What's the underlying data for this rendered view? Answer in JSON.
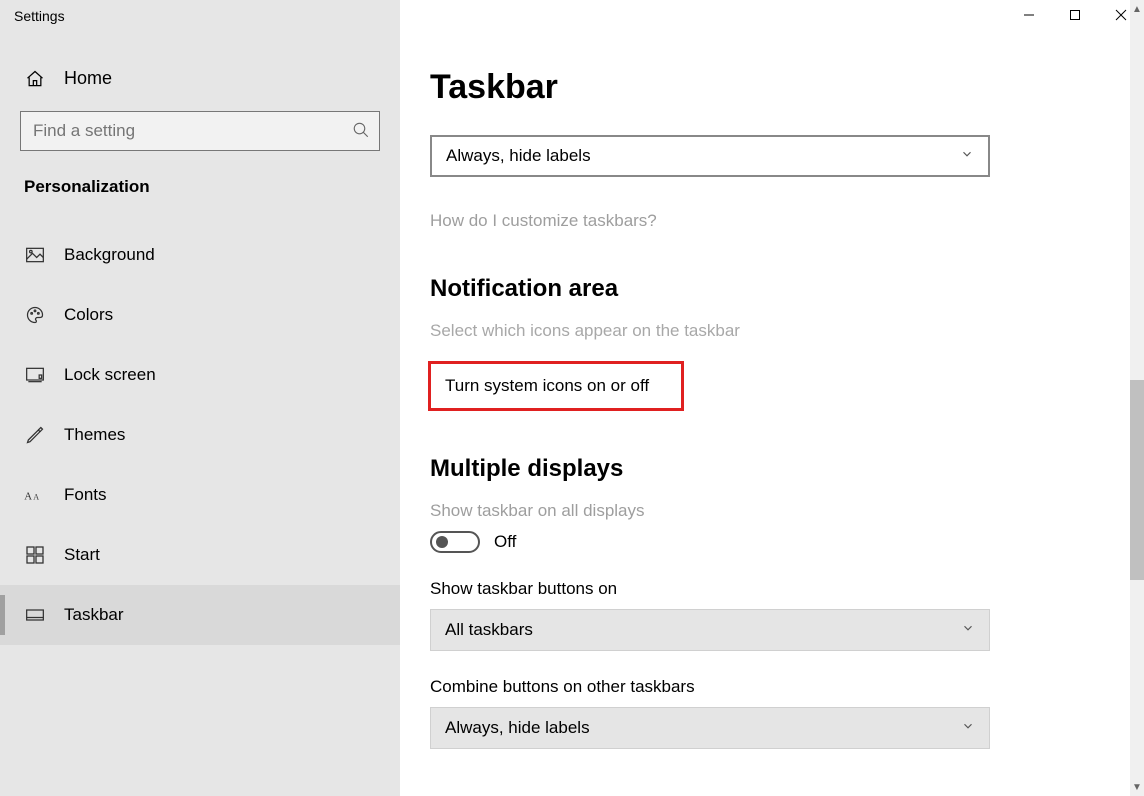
{
  "window": {
    "title": "Settings"
  },
  "sidebar": {
    "home": "Home",
    "search_placeholder": "Find a setting",
    "category": "Personalization",
    "items": [
      {
        "label": "Background"
      },
      {
        "label": "Colors"
      },
      {
        "label": "Lock screen"
      },
      {
        "label": "Themes"
      },
      {
        "label": "Fonts"
      },
      {
        "label": "Start"
      },
      {
        "label": "Taskbar"
      }
    ]
  },
  "main": {
    "title": "Taskbar",
    "dropdown1": "Always, hide labels",
    "help_link": "How do I customize taskbars?",
    "notification": {
      "heading": "Notification area",
      "link1": "Select which icons appear on the taskbar",
      "link2": "Turn system icons on or off"
    },
    "multiple": {
      "heading": "Multiple displays",
      "toggle_label": "Show taskbar on all displays",
      "toggle_state": "Off",
      "show_on_label": "Show taskbar buttons on",
      "show_on_value": "All taskbars",
      "combine_label": "Combine buttons on other taskbars",
      "combine_value": "Always, hide labels"
    }
  }
}
